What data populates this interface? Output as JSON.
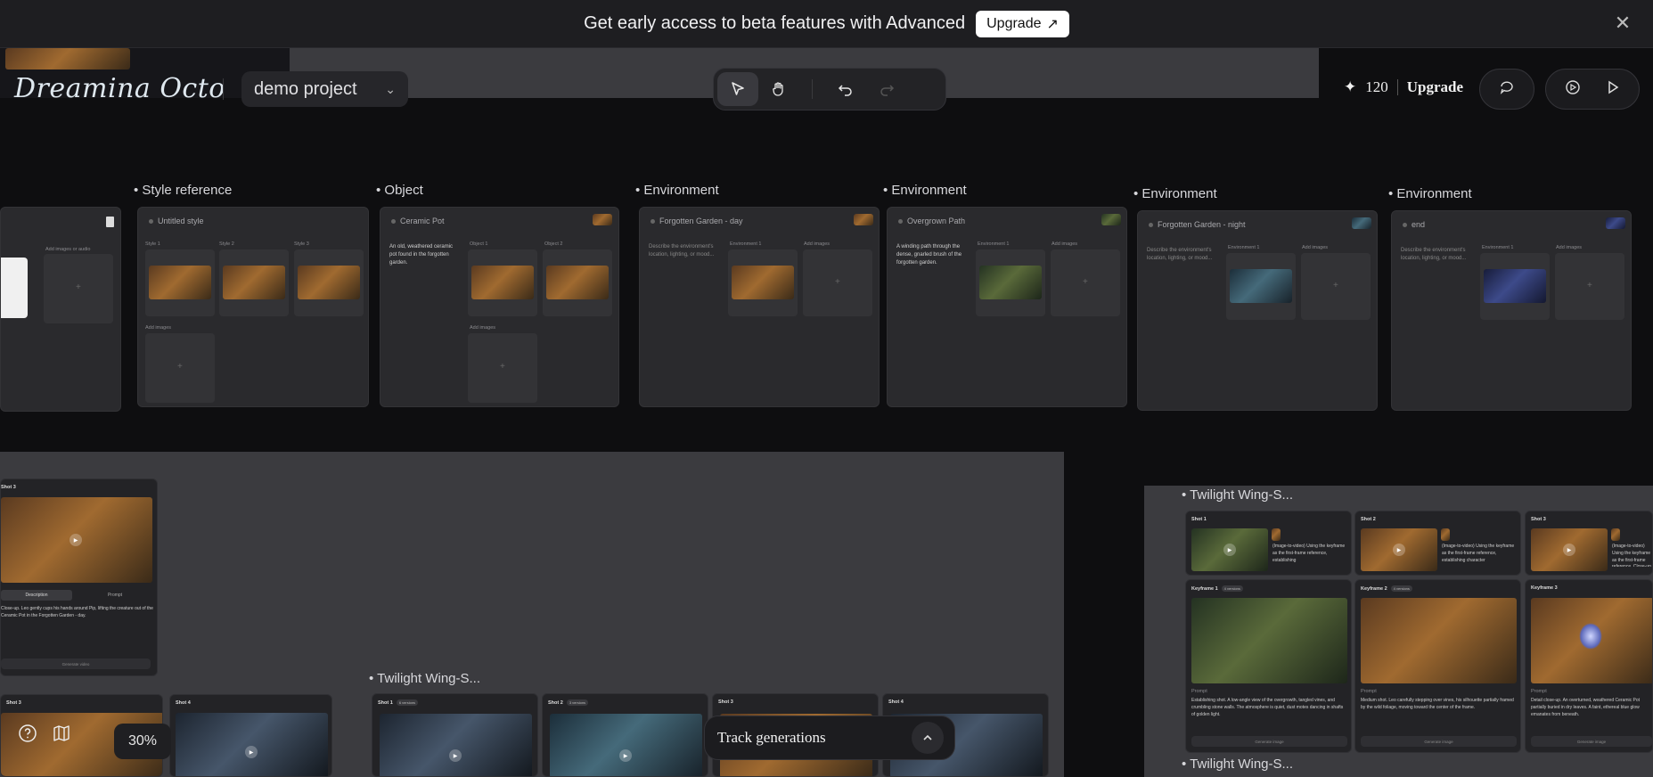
{
  "banner": {
    "text": "Get early access to beta features with Advanced",
    "upgrade_label": "Upgrade",
    "upgrade_icon": "arrow-up-right-icon",
    "close_icon": "close-icon"
  },
  "header": {
    "logo": "Dreamina Octo",
    "project_name": "demo project",
    "credits": "120",
    "upgrade_label": "Upgrade"
  },
  "toolbar": {
    "tools": [
      "select-pointer-icon",
      "hand-pan-icon",
      "undo-icon",
      "redo-icon"
    ]
  },
  "references": [
    {
      "label": "Style reference",
      "title": "Untitled style",
      "slots": [
        "Style 1",
        "Style 2",
        "Style 3"
      ],
      "add": "Add images"
    },
    {
      "label": "Object",
      "title": "Ceramic Pot",
      "desc": "An old, weathered ceramic pot found in the forgotten garden.",
      "slots": [
        "Object 1",
        "Object 2"
      ],
      "add": "Add images"
    },
    {
      "label": "Environment",
      "title": "Forgotten Garden - day",
      "desc": "Describe the environment's location, lighting, or mood...",
      "slots": [
        "Environment 1"
      ],
      "add": "Add images"
    },
    {
      "label": "Environment",
      "title": "Overgrown Path",
      "desc": "A winding path through the dense, gnarled brush of the forgotten garden.",
      "slots": [
        "Environment 1"
      ],
      "add": "Add images"
    },
    {
      "label": "Environment",
      "title": "Forgotten Garden - night",
      "desc": "Describe the environment's location, lighting, or mood...",
      "slots": [
        "Environment 1"
      ],
      "add": "Add images"
    },
    {
      "label": "Environment",
      "title": "end",
      "desc": "Describe the environment's location, lighting, or mood...",
      "slots": [
        "Environment 1"
      ],
      "add": "Add images"
    }
  ],
  "left_panel": {
    "add_label": "Add images or audio",
    "shot3_title": "Shot 3",
    "tab_description": "Description",
    "tab_prompt": "Prompt",
    "shot3_text": "Close-up. Leo gently cups his hands around Pip, lifting the creature out of the Ceramic Pot in the Forgotten Garden - day.",
    "generate_video": "Generate video",
    "shot3b_title": "Shot 3",
    "shot4_title": "Shot 4"
  },
  "sequence_bottom": {
    "label": "Twilight Wing-S...",
    "shots": [
      {
        "title": "Shot 1",
        "badge": "6 versions"
      },
      {
        "title": "Shot 2",
        "badge": "3 versions"
      },
      {
        "title": "Shot 3",
        "badge": ""
      },
      {
        "title": "Shot 4",
        "badge": ""
      }
    ]
  },
  "sequence_right": {
    "label": "Twilight Wing-S...",
    "label_bottom": "Twilight Wing-S...",
    "shots": [
      {
        "title": "Shot 1",
        "text": "(Image-to-video) Using the keyframe as the first-frame reference, establishing"
      },
      {
        "title": "Shot 2",
        "text": "(Image-to-video) Using the keyframe as the first-frame reference, establishing character"
      },
      {
        "title": "Shot 3",
        "text": "(Image-to-video) Using the keyframe as the first-frame reference. Close-up."
      }
    ],
    "keyframes": [
      {
        "title": "Keyframe 1",
        "badge": "4 versions",
        "prompt_label": "Prompt",
        "text": "Establishing shot. A low-angle view of the overgrowth, tangled vines, and crumbling stone walls. The atmosphere is quiet, dust motes dancing in shafts of golden light.",
        "button": "Generate image"
      },
      {
        "title": "Keyframe 2",
        "badge": "4 versions",
        "prompt_label": "Prompt",
        "text": "Medium shot. Leo carefully stepping over vines, his silhouette partially framed by the wild foliage, moving toward the center of the frame.",
        "button": "Generate image"
      },
      {
        "title": "Keyframe 3",
        "badge": "",
        "prompt_label": "Prompt",
        "text": "Detail close-up. An overturned, weathered Ceramic Pot partially buried in dry leaves. A faint, ethereal blue glow emanates from beneath.",
        "button": "Generate image"
      }
    ]
  },
  "bottom": {
    "help_icon": "help-icon",
    "map_icon": "map-icon",
    "zoom": "30%",
    "track_label": "Track generations",
    "track_icon": "chevron-up-icon"
  }
}
